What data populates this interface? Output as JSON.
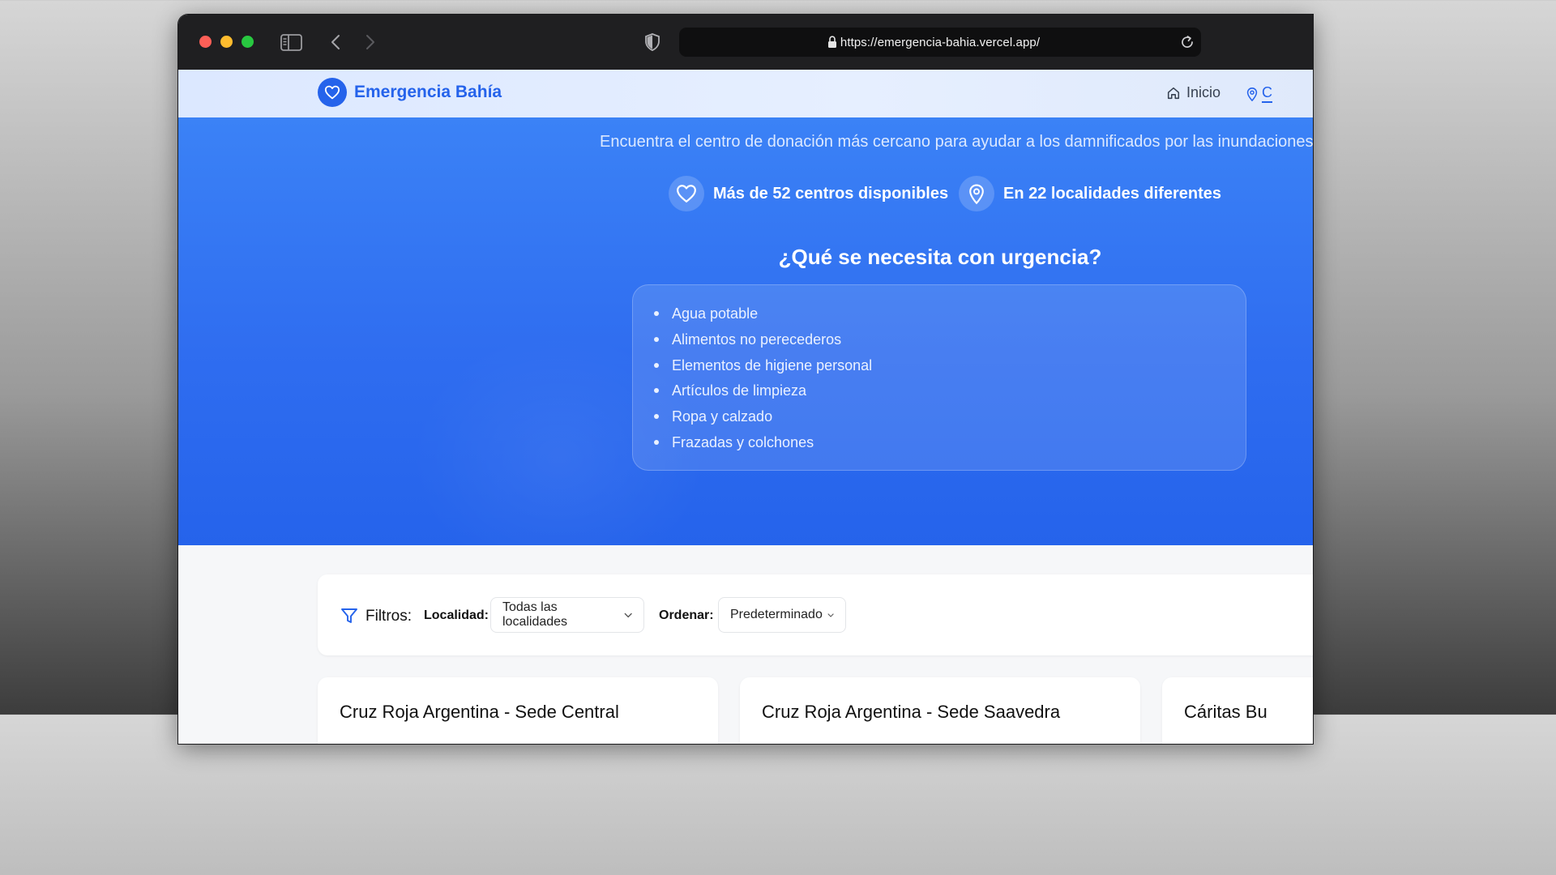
{
  "browser": {
    "url": "https://emergencia-bahia.vercel.app/"
  },
  "navbar": {
    "brand": "Emergencia Bahía",
    "links": [
      {
        "label": "Inicio",
        "icon": "home-icon"
      },
      {
        "label": "C",
        "icon": "map-pin-icon"
      }
    ]
  },
  "hero": {
    "subtitle": "Encuentra el centro de donación más cercano para ayudar a los damnificados por las inundaciones",
    "stats": [
      {
        "label": "Más de 52 centros disponibles",
        "icon": "heart-icon"
      },
      {
        "label": "En 22 localidades diferentes",
        "icon": "map-pin-icon"
      }
    ],
    "urgent_title": "¿Qué se necesita con urgencia?",
    "needs": [
      "Agua potable",
      "Alimentos no perecederos",
      "Elementos de higiene personal",
      "Artículos de limpieza",
      "Ropa y calzado",
      "Frazadas y colchones"
    ]
  },
  "filters": {
    "title": "Filtros:",
    "locality_label": "Localidad:",
    "locality_value": "Todas las localidades",
    "sort_label": "Ordenar:",
    "sort_value": "Predeterminado"
  },
  "cards": [
    {
      "title": "Cruz Roja Argentina - Sede Central"
    },
    {
      "title": "Cruz Roja Argentina - Sede Saavedra"
    },
    {
      "title": "Cáritas Bu"
    }
  ],
  "colors": {
    "brand": "#2563eb",
    "hero_top": "#3b82f6",
    "hero_bottom": "#2563eb"
  }
}
